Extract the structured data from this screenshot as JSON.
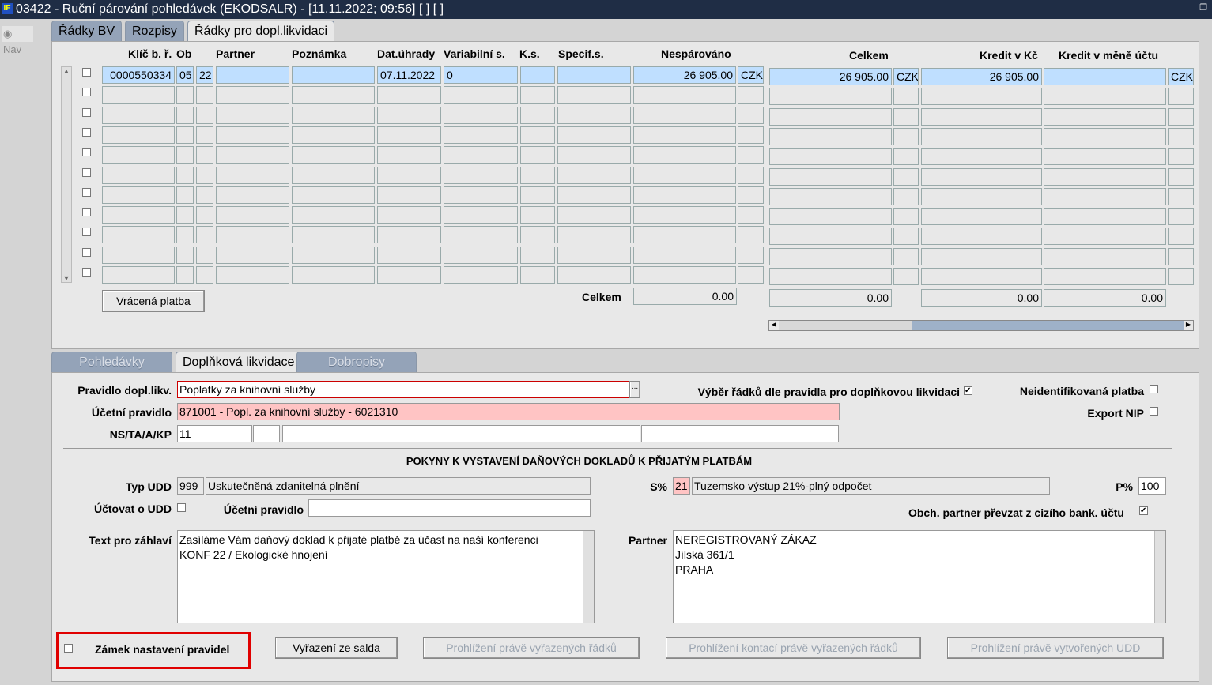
{
  "window": {
    "title": "03422 - Ruční párování pohledávek (EKODSALR) - [11.11.2022; 09:56]  [ ]  [ ]",
    "logo": "IF",
    "restore_icon": "restore-icon"
  },
  "nav": "Nav",
  "top_tabs": [
    "Řádky BV",
    "Rozpisy",
    "Řádky pro dopl.likvidaci"
  ],
  "grid": {
    "headers": {
      "klic": "Klíč b. ř.",
      "ob": "Ob",
      "partner": "Partner",
      "poznamka": "Poznámka",
      "dat": "Dat.úhrady",
      "var": "Variabilní s.",
      "ks": "K.s.",
      "spec": "Specif.s.",
      "nesp": "Nespárováno",
      "celkem": "Celkem",
      "kredit": "Kredit v Kč",
      "kredit_mena": "Kredit v měně účtu"
    },
    "rows": [
      [
        "0000550334",
        "05",
        "22",
        "",
        "",
        "07.11.2022",
        "0",
        "",
        "",
        "26 905.00",
        "CZK",
        "26 905.00",
        "CZK",
        "26 905.00",
        "",
        "CZK"
      ],
      [
        "",
        "",
        "",
        "",
        "",
        "",
        "",
        "",
        "",
        "",
        "",
        "",
        "",
        "",
        "",
        ""
      ],
      [
        "",
        "",
        "",
        "",
        "",
        "",
        "",
        "",
        "",
        "",
        "",
        "",
        "",
        "",
        "",
        ""
      ],
      [
        "",
        "",
        "",
        "",
        "",
        "",
        "",
        "",
        "",
        "",
        "",
        "",
        "",
        "",
        "",
        ""
      ],
      [
        "",
        "",
        "",
        "",
        "",
        "",
        "",
        "",
        "",
        "",
        "",
        "",
        "",
        "",
        "",
        ""
      ],
      [
        "",
        "",
        "",
        "",
        "",
        "",
        "",
        "",
        "",
        "",
        "",
        "",
        "",
        "",
        "",
        ""
      ],
      [
        "",
        "",
        "",
        "",
        "",
        "",
        "",
        "",
        "",
        "",
        "",
        "",
        "",
        "",
        "",
        ""
      ],
      [
        "",
        "",
        "",
        "",
        "",
        "",
        "",
        "",
        "",
        "",
        "",
        "",
        "",
        "",
        "",
        ""
      ],
      [
        "",
        "",
        "",
        "",
        "",
        "",
        "",
        "",
        "",
        "",
        "",
        "",
        "",
        "",
        "",
        ""
      ],
      [
        "",
        "",
        "",
        "",
        "",
        "",
        "",
        "",
        "",
        "",
        "",
        "",
        "",
        "",
        "",
        ""
      ],
      [
        "",
        "",
        "",
        "",
        "",
        "",
        "",
        "",
        "",
        "",
        "",
        "",
        "",
        "",
        "",
        ""
      ]
    ],
    "returned_payment_button": "Vrácená platba",
    "totals_label": "Celkem",
    "totals": {
      "nesp": "0.00",
      "celkem": "0.00",
      "kredit": "0.00",
      "kredit_mena": "0.00"
    }
  },
  "bottom_tabs": [
    "Pohledávky",
    "Doplňková likvidace",
    "Dobropisy"
  ],
  "form": {
    "pravidlo_label": "Pravidlo dopl.likv.",
    "pravidlo_value": "Poplatky za knihovní služby",
    "lov_button": "...",
    "vyber_label": "Výběr řádků dle pravidla pro doplňkovou likvidaci",
    "neident_label": "Neidentifikovaná platba",
    "ucetni_label": "Účetní pravidlo",
    "ucetni_value": "871001 - Popl. za knihovní služby - 6021310",
    "export_label": "Export NIP",
    "ns_label": "NS/TA/A/KP",
    "ns_value": "11",
    "section_title": "POKYNY K VYSTAVENÍ DAŇOVÝCH DOKLADŮ K PŘIJATÝM PLATBÁM",
    "typ_label": "Typ UDD",
    "typ_code": "999",
    "typ_value": "Uskutečněná zdanitelná plnění",
    "s_label": "S%",
    "s_code": "21",
    "s_value": "Tuzemsko výstup 21%-plný odpočet",
    "p_label": "P%",
    "p_value": "100",
    "uctovat_label": "Účtovat o UDD",
    "ucetni2_label": "Účetní pravidlo",
    "obch_label": "Obch. partner převzat z cizího bank. účtu",
    "text_label": "Text pro záhlaví",
    "text_lines": [
      "Zasíláme Vám daňový doklad k přijaté platbě za účast na naší konferenci",
      "KONF 22 / Ekologické hnojení"
    ],
    "partner_label": "Partner",
    "partner_lines": [
      "NEREGISTROVANÝ ZÁKAZ",
      "Jílská 361/1",
      "PRAHA"
    ]
  },
  "footer": {
    "zamek_label": "Zámek nastavení pravidel",
    "buttons": [
      "Vyřazení ze salda",
      "Prohlížení právě vyřazených řádků",
      "Prohlížení kontací právě vyřazených řádků",
      "Prohlížení právě vytvořených UDD"
    ]
  },
  "colors": {
    "titlebar": "#1f2d45",
    "selected": "#bfdfff",
    "error": "#ffc4c4",
    "highlight": "#e00000"
  }
}
